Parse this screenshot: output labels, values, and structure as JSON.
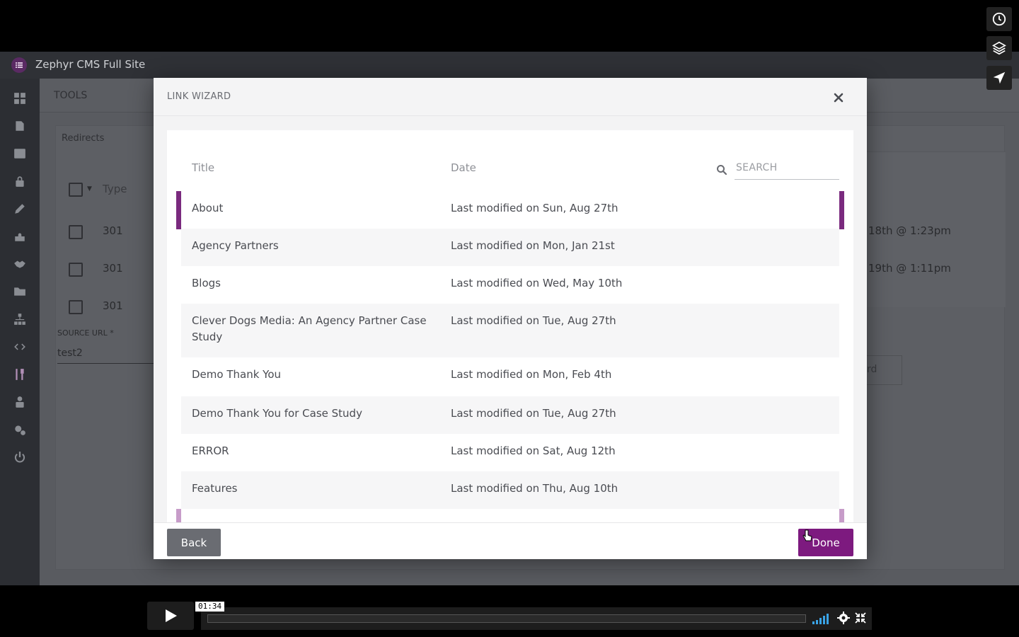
{
  "app": {
    "title": "Zephyr CMS Full Site",
    "tools_label": "TOOLS",
    "card_title": "Redirects",
    "type_header": "Type",
    "rows": [
      {
        "type": "301",
        "date_fragment": "18th @ 1:23pm"
      },
      {
        "type": "301",
        "date_fragment": "19th @ 1:11pm"
      },
      {
        "type": "301"
      }
    ],
    "source_label": "SOURCE URL *",
    "source_value": "test2",
    "bg_button_fragment": "rd"
  },
  "modal": {
    "title": "LINK WIZARD",
    "columns": {
      "title": "Title",
      "date": "Date"
    },
    "search_placeholder": "SEARCH",
    "items": [
      {
        "title": "About",
        "date": "Last modified on Sun, Aug 27th"
      },
      {
        "title": "Agency Partners",
        "date": "Last modified on Mon, Jan 21st"
      },
      {
        "title": "Blogs",
        "date": "Last modified on Wed, May 10th"
      },
      {
        "title": "Clever Dogs Media: An Agency Partner Case Study",
        "date": "Last modified on Tue, Aug 27th"
      },
      {
        "title": "Demo Thank You",
        "date": "Last modified on Mon, Feb 4th"
      },
      {
        "title": "Demo Thank You for Case Study",
        "date": "Last modified on Tue, Aug 27th"
      },
      {
        "title": "ERROR",
        "date": "Last modified on Sat, Aug 12th"
      },
      {
        "title": "Features",
        "date": "Last modified on Thu, Aug 10th"
      }
    ],
    "back_label": "Back",
    "done_label": "Done"
  },
  "player": {
    "time": "01:34"
  },
  "colors": {
    "accent": "#7d1a7f",
    "selection_bar": "#7a2a7e"
  }
}
